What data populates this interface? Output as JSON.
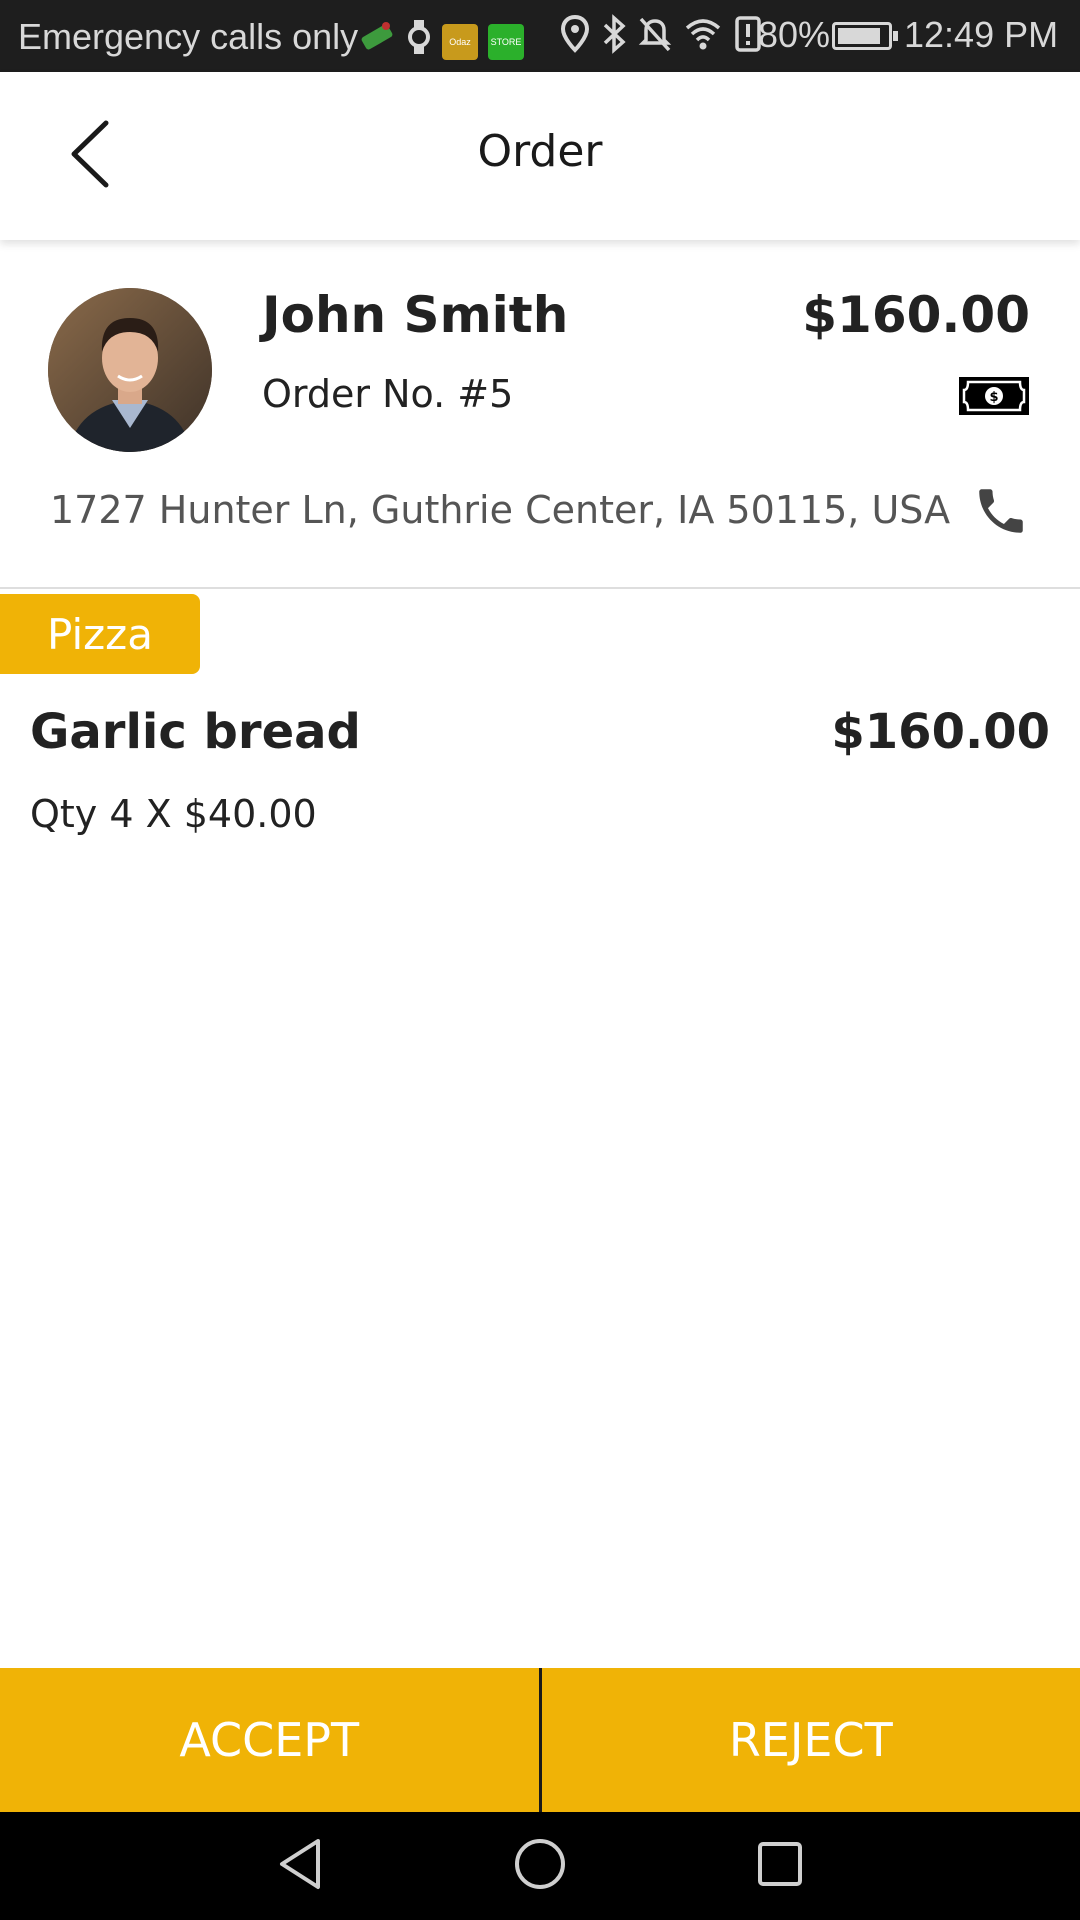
{
  "status_bar": {
    "carrier": "Emergency calls only",
    "notification_apps": [
      {
        "icon": "game-app-icon",
        "label": "",
        "color": "#3d9a3d"
      },
      {
        "icon": "watch-icon",
        "label": "",
        "color": "#d8d8d8"
      },
      {
        "icon": "odaz-app-icon",
        "label": "Odaz",
        "color": "#c89a1c"
      },
      {
        "icon": "store-app-icon",
        "label": "STORE",
        "color": "#2bb02b"
      }
    ],
    "system_icons": [
      "location-icon",
      "bluetooth-icon",
      "mute-icon",
      "wifi-icon",
      "battery-alert-icon"
    ],
    "battery_percent": "80%",
    "battery_level": 0.8,
    "time": "12:49 PM"
  },
  "app_bar": {
    "title": "Order",
    "back_icon": "back-chevron-icon"
  },
  "customer": {
    "name": "John Smith",
    "order_number": "Order No. #5",
    "total": "$160.00",
    "payment_icon": "cash-icon",
    "address": "1727 Hunter Ln, Guthrie Center, IA 50115, USA",
    "phone_icon": "phone-icon"
  },
  "items": {
    "category": "Pizza",
    "entries": [
      {
        "name": "Garlic bread",
        "price": "$160.00",
        "quantity_line": "Qty 4 X $40.00"
      }
    ]
  },
  "actions": {
    "accept_label": "ACCEPT",
    "reject_label": "REJECT"
  },
  "colors": {
    "accent": "#f0b306",
    "status_bar_bg": "#1e1e1e",
    "nav_bar_bg": "#000000"
  }
}
